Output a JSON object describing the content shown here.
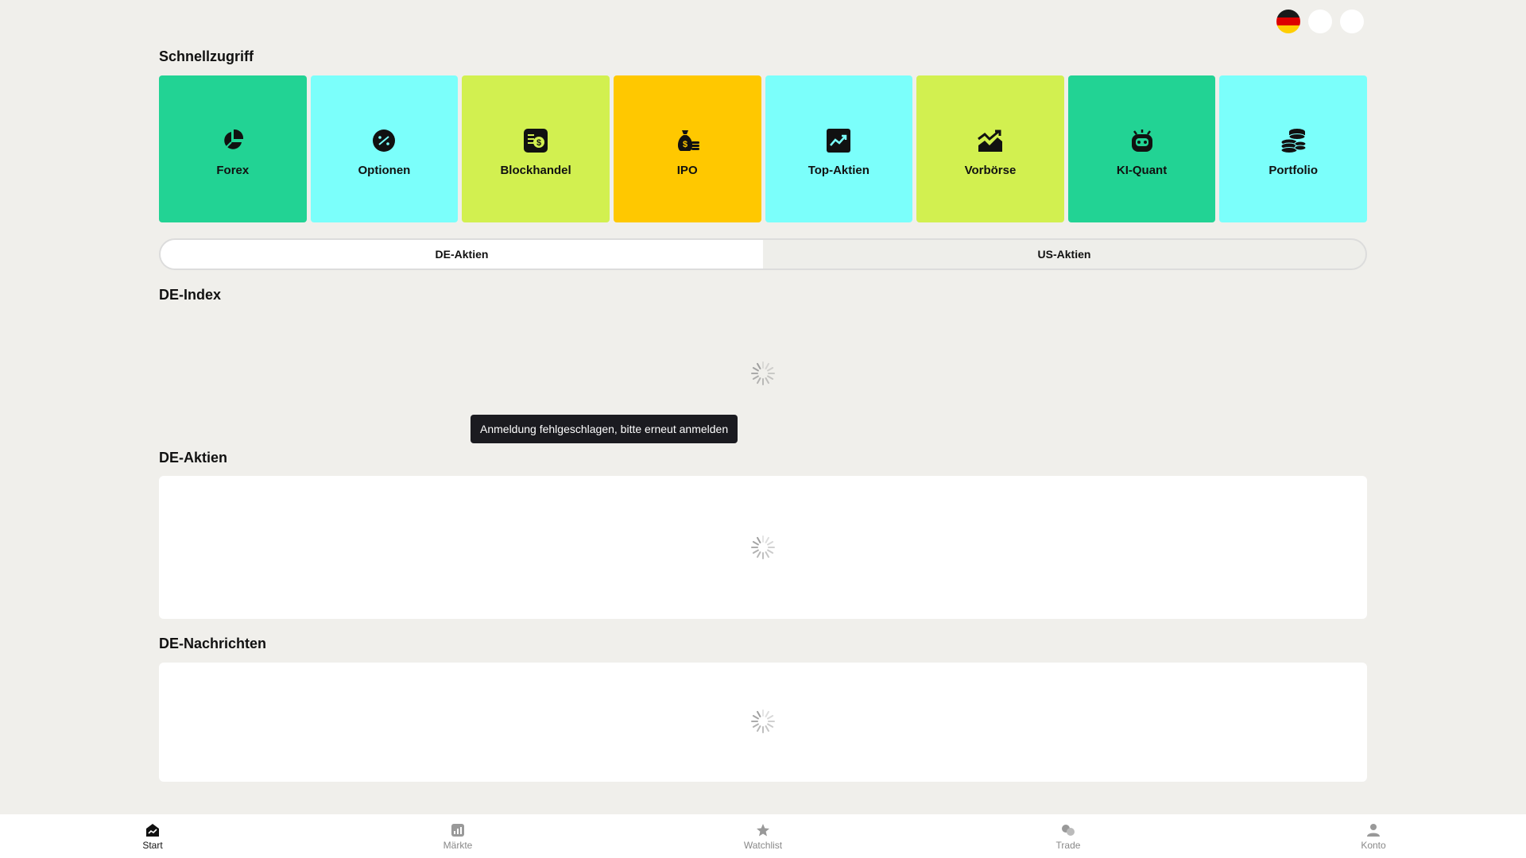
{
  "quick_access": {
    "title": "Schnellzugriff",
    "tiles": [
      {
        "label": "Forex",
        "color": "#22d394"
      },
      {
        "label": "Optionen",
        "color": "#7bfffb"
      },
      {
        "label": "Blockhandel",
        "color": "#d2f050"
      },
      {
        "label": "IPO",
        "color": "#ffc800"
      },
      {
        "label": "Top-Aktien",
        "color": "#7bfffb"
      },
      {
        "label": "Vorbörse",
        "color": "#d2f050"
      },
      {
        "label": "KI-Quant",
        "color": "#22d394"
      },
      {
        "label": "Portfolio",
        "color": "#7bfffb"
      }
    ]
  },
  "market_tabs": {
    "tabs": [
      {
        "label": "DE-Aktien",
        "active": true
      },
      {
        "label": "US-Aktien",
        "active": false
      }
    ]
  },
  "sections": {
    "index_title": "DE-Index",
    "stocks_title": "DE-Aktien",
    "news_title": "DE-Nachrichten"
  },
  "toast": {
    "message": "Anmeldung fehlgeschlagen, bitte erneut anmelden"
  },
  "bottom_nav": {
    "items": [
      {
        "label": "Start",
        "icon": "home-chart-icon",
        "active": true
      },
      {
        "label": "Märkte",
        "icon": "markets-icon",
        "active": false
      },
      {
        "label": "Watchlist",
        "icon": "star-icon",
        "active": false
      },
      {
        "label": "Trade",
        "icon": "trade-icon",
        "active": false
      },
      {
        "label": "Konto",
        "icon": "user-icon",
        "active": false
      }
    ]
  }
}
